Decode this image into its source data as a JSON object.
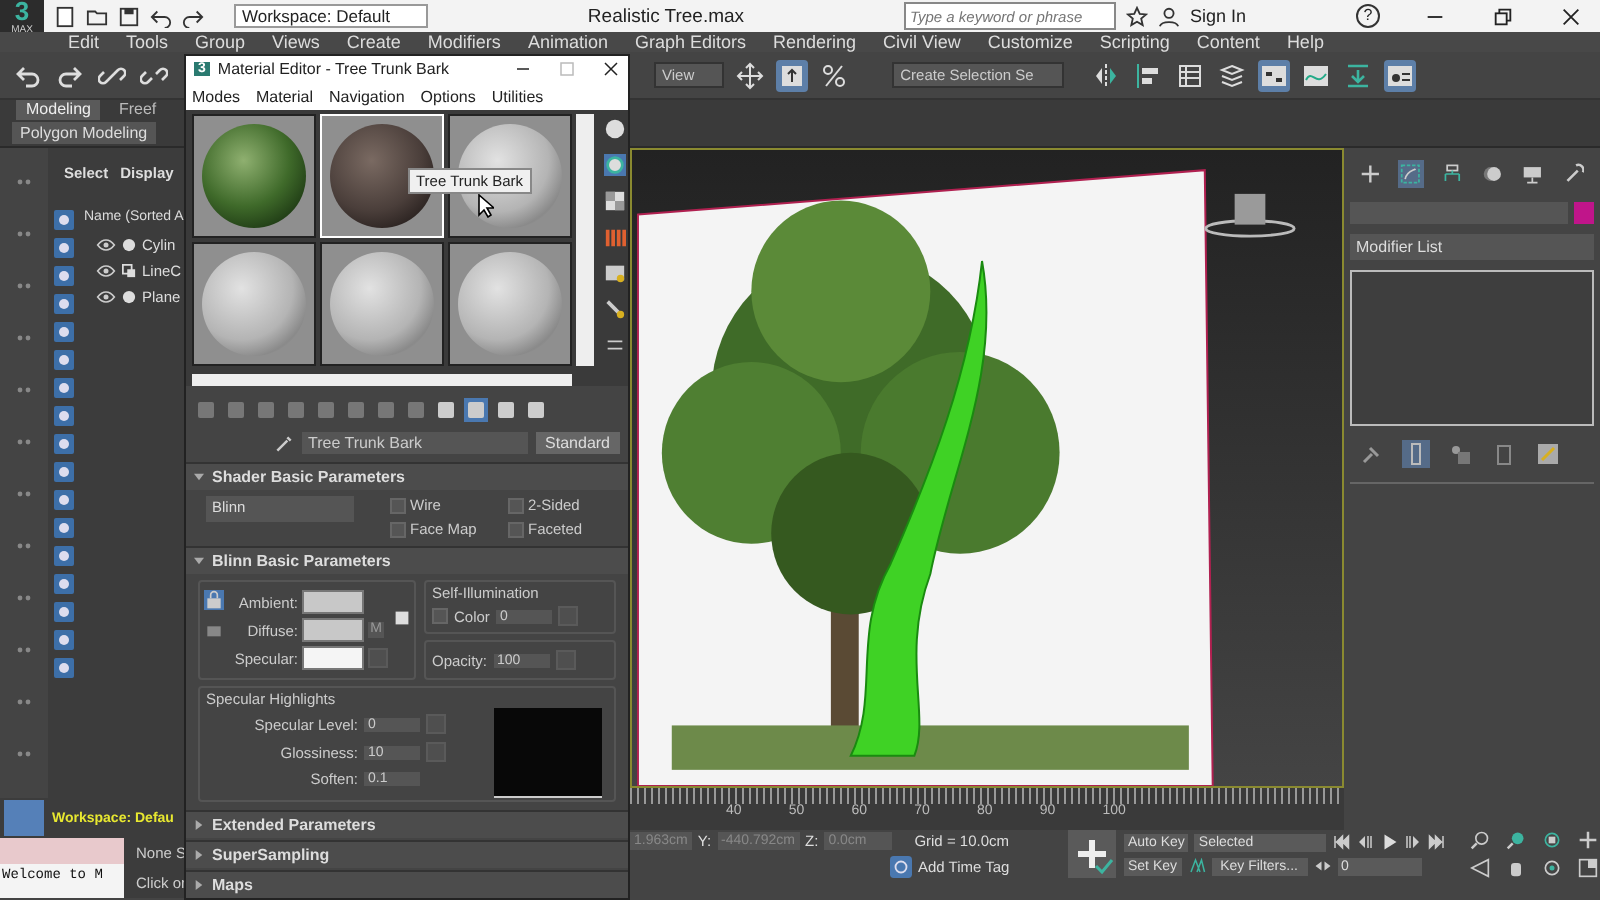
{
  "title_bar": {
    "logo": "3",
    "logo_sub": "MAX",
    "workspace": "Workspace: Default",
    "title": "Realistic Tree.max",
    "search": {
      "placeholder": "Type a keyword or phrase"
    },
    "sign_in": "Sign In",
    "help": "?"
  },
  "menu_bar": [
    "Edit",
    "Tools",
    "Group",
    "Views",
    "Create",
    "Modifiers",
    "Animation",
    "Graph Editors",
    "Rendering",
    "Civil View",
    "Customize",
    "Scripting",
    "Content",
    "Help"
  ],
  "toolbar": {
    "view_dropdown": "View",
    "selection_set": "Create Selection Se"
  },
  "ribbon": {
    "tabs": [
      {
        "label": "Modeling",
        "selected": true
      },
      {
        "label": "Freef",
        "selected": false
      }
    ],
    "panel": "Polygon Modeling"
  },
  "scene_explorer": {
    "tabs": [
      "Select",
      "Display"
    ],
    "column": "Name (Sorted A",
    "items": [
      {
        "name": "Cylin",
        "kind": "geometry"
      },
      {
        "name": "LineC",
        "kind": "shape"
      },
      {
        "name": "Plane",
        "kind": "geometry"
      }
    ]
  },
  "status": {
    "workspace": "Workspace: Defau",
    "listener": "Welcome to M",
    "line_1": "None S",
    "line_2": "Click or"
  },
  "material_editor": {
    "logo": "3",
    "title": "Material Editor - Tree Trunk Bark",
    "menus": [
      "Modes",
      "Material",
      "Navigation",
      "Options",
      "Utilities"
    ],
    "slots": [
      {
        "kind": "leaves",
        "selected": false
      },
      {
        "kind": "bark",
        "selected": true
      },
      {
        "kind": "plain",
        "selected": false
      },
      {
        "kind": "plain",
        "selected": false
      },
      {
        "kind": "plain",
        "selected": false
      },
      {
        "kind": "plain",
        "selected": false
      }
    ],
    "tooltip": "Tree Trunk Bark",
    "material_name": "Tree Trunk Bark",
    "material_type": "Standard",
    "shader": {
      "title": "Shader Basic Parameters",
      "shader_type": "Blinn",
      "options": [
        {
          "label": "Wire",
          "checked": false
        },
        {
          "label": "2-Sided",
          "checked": false
        },
        {
          "label": "Face Map",
          "checked": false
        },
        {
          "label": "Faceted",
          "checked": false
        }
      ]
    },
    "blinn": {
      "title": "Blinn Basic Parameters",
      "colors": [
        {
          "label": "Ambient:",
          "color": "#c8c8c8"
        },
        {
          "label": "Diffuse:",
          "color": "#c8c8c8"
        },
        {
          "label": "Specular:",
          "color": "#f5f5f5"
        }
      ],
      "map_button": "M",
      "self_illumination": {
        "title": "Self-Illumination",
        "label": "Color",
        "checked": false,
        "value": "0"
      },
      "opacity": {
        "label": "Opacity:",
        "value": "100"
      },
      "highlights": {
        "title": "Specular Highlights",
        "fields": [
          {
            "label": "Specular Level:",
            "value": "0"
          },
          {
            "label": "Glossiness:",
            "value": "10"
          },
          {
            "label": "Soften:",
            "value": "0.1"
          }
        ]
      }
    },
    "collapsed": [
      {
        "title": "Extended Parameters"
      },
      {
        "title": "SuperSampling"
      },
      {
        "title": "Maps"
      }
    ]
  },
  "command_panel": {
    "name_field": {
      "color": "#c0158a"
    },
    "modifier_list": "Modifier List"
  },
  "timeline": {
    "ticks": [
      "40",
      "50",
      "60",
      "70",
      "80",
      "90",
      "100"
    ]
  },
  "coordinates": {
    "x": "1.963cm",
    "y_label": "Y:",
    "y": "-440.792cm",
    "z_label": "Z:",
    "z": "0.0cm",
    "grid": "Grid = 10.0cm",
    "time_tag": "Add Time Tag"
  },
  "animation": {
    "auto_key": "Auto Key",
    "key_mode": "Selected",
    "set_key": "Set Key",
    "key_filters": "Key Filters...",
    "frame": "0"
  }
}
